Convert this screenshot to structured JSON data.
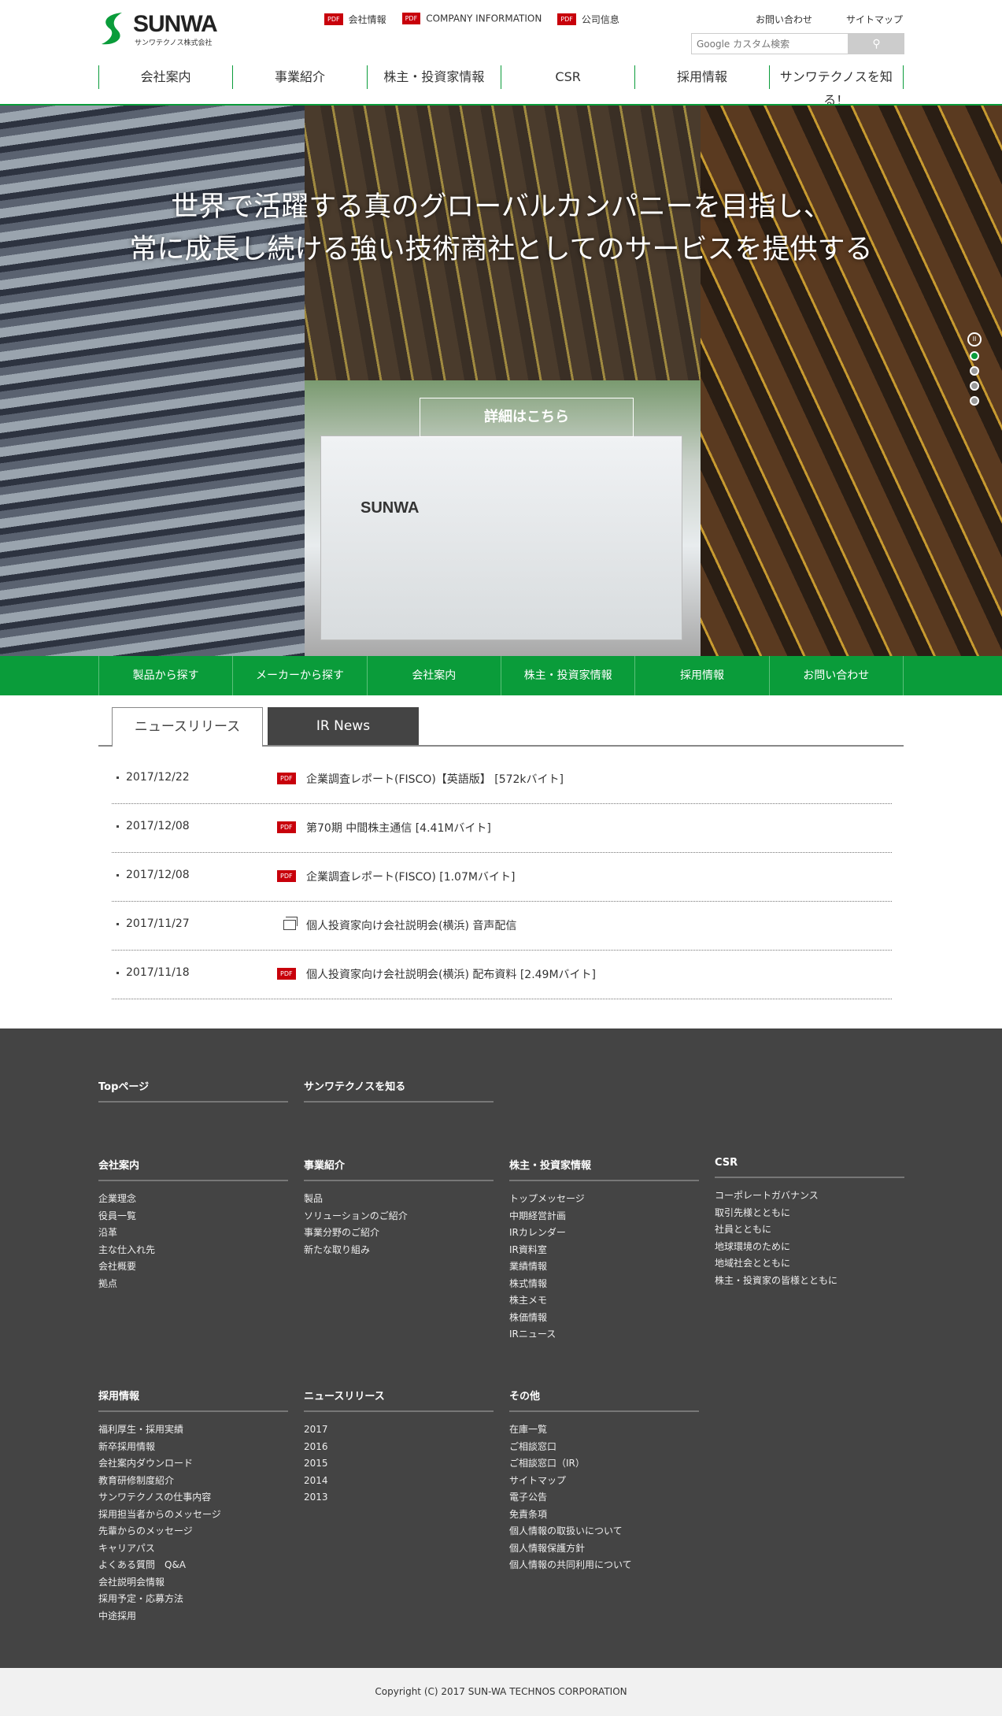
{
  "header": {
    "logo": {
      "word": "SUNWA",
      "sub": "サンワテクノス株式会社",
      "color": "#0a9c3a"
    },
    "pdf_badge": "PDF",
    "pdf_links": [
      "会社情報",
      "COMPANY INFORMATION",
      "公司信息"
    ],
    "contact": "お問い合わせ",
    "sitemap": "サイトマップ",
    "search": {
      "placeholder": "Google カスタム検索",
      "button_icon": "search-icon"
    },
    "nav": [
      "会社案内",
      "事業紹介",
      "株主・投資家情報",
      "CSR",
      "採用情報",
      "サンワテクノスを知る！"
    ]
  },
  "hero": {
    "headline_1": "世界で活躍する真のグローバルカンパニーを目指し、",
    "headline_2": "常に成長し続ける強い技術商社としてのサービスを提供する",
    "button": "詳細はこちら",
    "sign_text": "SUNWA",
    "slide_count": 4,
    "active_slide": 1
  },
  "greenbar": [
    "製品から探す",
    "メーカーから探す",
    "会社案内",
    "株主・投資家情報",
    "採用情報",
    "お問い合わせ"
  ],
  "tabs": {
    "active": "ニュースリリース",
    "inactive": "IR News"
  },
  "news": [
    {
      "date": "2017/12/22",
      "icon": "pdf",
      "title": "企業調査レポート(FISCO)【英語版】 [572kバイト]"
    },
    {
      "date": "2017/12/08",
      "icon": "pdf",
      "title": "第70期 中間株主通信 [4.41Mバイト]"
    },
    {
      "date": "2017/12/08",
      "icon": "pdf",
      "title": "企業調査レポート(FISCO) [1.07Mバイト]"
    },
    {
      "date": "2017/11/27",
      "icon": "window",
      "title": "個人投資家向け会社説明会(横浜) 音声配信"
    },
    {
      "date": "2017/11/18",
      "icon": "pdf",
      "title": "個人投資家向け会社説明会(横浜) 配布資料 [2.49Mバイト]"
    }
  ],
  "footer": {
    "row1": [
      {
        "heading": "Topページ",
        "items": []
      },
      {
        "heading": "サンワテクノスを知る",
        "items": []
      }
    ],
    "row2": [
      {
        "heading": "会社案内",
        "items": [
          "企業理念",
          "役員一覧",
          "沿革",
          "主な仕入れ先",
          "会社概要",
          "拠点"
        ]
      },
      {
        "heading": "事業紹介",
        "items": [
          "製品",
          "ソリューションのご紹介",
          "事業分野のご紹介",
          "新たな取り組み"
        ]
      },
      {
        "heading": "株主・投資家情報",
        "items": [
          "トップメッセージ",
          "中期経営計画",
          "IRカレンダー",
          "IR資料室",
          "業績情報",
          "株式情報",
          "株主メモ",
          "株価情報",
          "IRニュース"
        ]
      },
      {
        "heading": "CSR",
        "items": [
          "コーポレートガバナンス",
          "取引先様とともに",
          "社員とともに",
          "地球環境のために",
          "地域社会とともに",
          "株主・投資家の皆様とともに"
        ]
      }
    ],
    "row3": [
      {
        "heading": "採用情報",
        "items": [
          "福利厚生・採用実績",
          "新卒採用情報",
          "会社案内ダウンロード",
          "教育研修制度紹介",
          "サンワテクノスの仕事内容",
          "採用担当者からのメッセージ",
          "先輩からのメッセージ",
          "キャリアパス",
          "よくある質問　Q&A",
          "会社説明会情報",
          "採用予定・応募方法",
          "中途採用"
        ]
      },
      {
        "heading": "ニュースリリース",
        "items": [
          "2017",
          "2016",
          "2015",
          "2014",
          "2013"
        ]
      },
      {
        "heading": "その他",
        "items": [
          "在庫一覧",
          "ご相談窓口",
          "ご相談窓口（IR）",
          "サイトマップ",
          "電子公告",
          "免責条項",
          "個人情報の取扱いについて",
          "個人情報保護方針",
          "個人情報の共同利用について"
        ]
      }
    ],
    "copyright": "Copyright (C) 2017 SUN-WA TECHNOS CORPORATION"
  }
}
